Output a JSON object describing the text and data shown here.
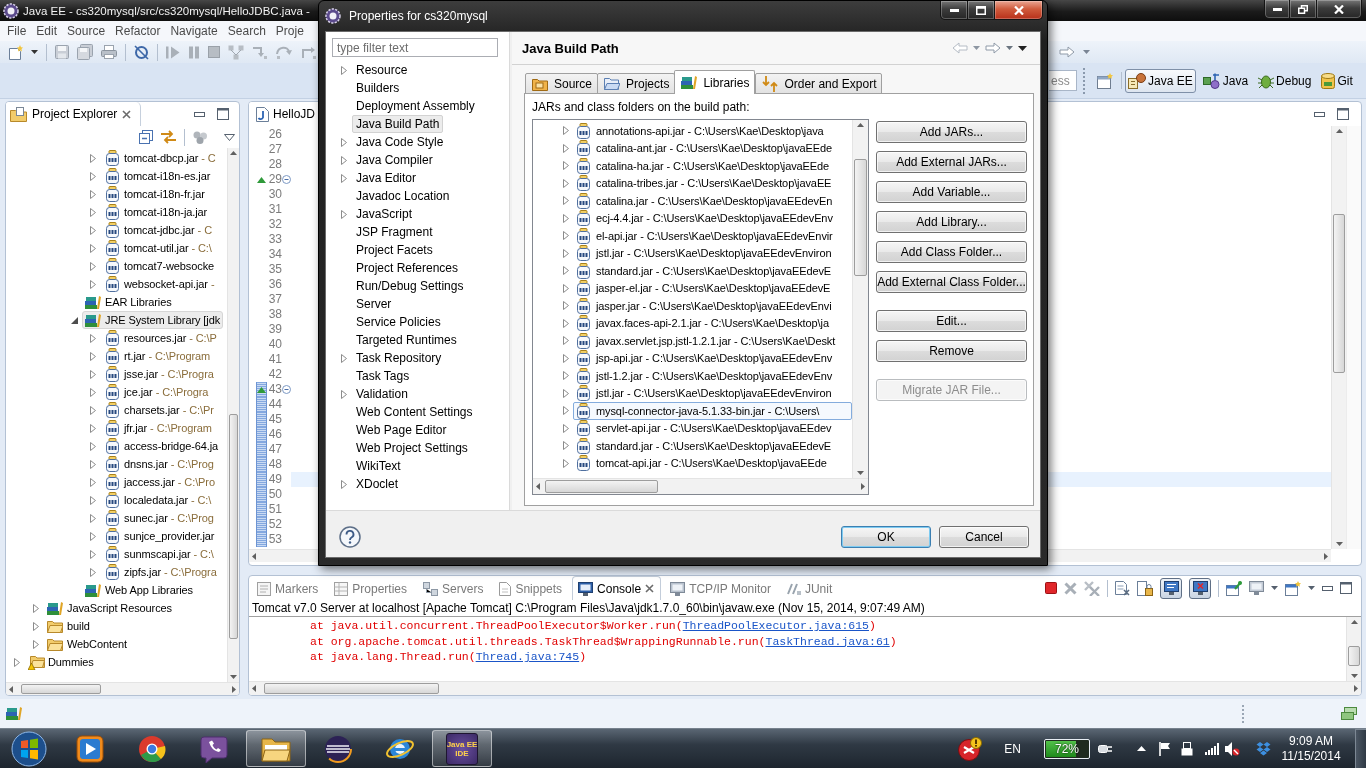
{
  "ide_window": {
    "title": "Java EE - cs320mysql/src/cs320mysql/HelloJDBC.java -",
    "menu": [
      "File",
      "Edit",
      "Source",
      "Refactor",
      "Navigate",
      "Search",
      "Proje"
    ],
    "quick_access": {
      "placeholder": "ess"
    },
    "perspectives": [
      {
        "label": "Java EE",
        "selected": true
      },
      {
        "label": "Java",
        "selected": false
      },
      {
        "label": "Debug",
        "selected": false
      },
      {
        "label": "Git",
        "selected": false
      }
    ],
    "project_explorer": {
      "title": "Project Explorer",
      "tree": [
        {
          "children": [
            {
              "children": [
                {
                  "children": [
                    {
                      "children": [
                        {
                          "kind": "jar",
                          "label": "tomcat-dbcp.jar",
                          "detail": "- C",
                          "expandable": true,
                          "expanded": false,
                          "selected": false
                        },
                        {
                          "kind": "jar",
                          "label": "tomcat-i18n-es.jar",
                          "expandable": true,
                          "expanded": false,
                          "selected": false
                        },
                        {
                          "kind": "jar",
                          "label": "tomcat-i18n-fr.jar",
                          "expandable": true,
                          "expanded": false,
                          "selected": false
                        },
                        {
                          "kind": "jar",
                          "label": "tomcat-i18n-ja.jar",
                          "expandable": true,
                          "expanded": false,
                          "selected": false
                        },
                        {
                          "kind": "jar",
                          "label": "tomcat-jdbc.jar",
                          "detail": "- C",
                          "expandable": true,
                          "expanded": false,
                          "selected": false
                        },
                        {
                          "kind": "jar",
                          "label": "tomcat-util.jar",
                          "detail": "- C:\\",
                          "expandable": true,
                          "expanded": false,
                          "selected": false
                        },
                        {
                          "kind": "jar",
                          "label": "tomcat7-websocke",
                          "expandable": true,
                          "expanded": false,
                          "selected": false
                        },
                        {
                          "kind": "jar",
                          "label": "websocket-api.jar",
                          "detail": "-",
                          "expandable": true,
                          "expanded": false,
                          "selected": false
                        }
                      ]
                    },
                    {
                      "kind": "library",
                      "label": "EAR Libraries",
                      "expandable": false,
                      "selected": false
                    },
                    {
                      "kind": "library",
                      "label": "JRE System Library [jdk",
                      "expandable": true,
                      "expanded": true,
                      "selected": true,
                      "children": [
                        {
                          "kind": "jar",
                          "label": "resources.jar",
                          "detail": "- C:\\P",
                          "expandable": true,
                          "expanded": false,
                          "selected": false
                        },
                        {
                          "kind": "jar",
                          "label": "rt.jar",
                          "detail": "- C:\\Program",
                          "expandable": true,
                          "expanded": false,
                          "selected": false
                        },
                        {
                          "kind": "jar",
                          "label": "jsse.jar",
                          "detail": "- C:\\Progra",
                          "expandable": true,
                          "expanded": false,
                          "selected": false
                        },
                        {
                          "kind": "jar",
                          "label": "jce.jar",
                          "detail": "- C:\\Progra",
                          "expandable": true,
                          "expanded": false,
                          "selected": false
                        },
                        {
                          "kind": "jar",
                          "label": "charsets.jar",
                          "detail": "- C:\\Pr",
                          "expandable": true,
                          "expanded": false,
                          "selected": false
                        },
                        {
                          "kind": "jar",
                          "label": "jfr.jar",
                          "detail": "- C:\\Program",
                          "expandable": true,
                          "expanded": false,
                          "selected": false
                        },
                        {
                          "kind": "jar",
                          "label": "access-bridge-64.ja",
                          "expandable": true,
                          "expanded": false,
                          "selected": false
                        },
                        {
                          "kind": "jar",
                          "label": "dnsns.jar",
                          "detail": "- C:\\Prog",
                          "expandable": true,
                          "expanded": false,
                          "selected": false
                        },
                        {
                          "kind": "jar",
                          "label": "jaccess.jar",
                          "detail": "- C:\\Pro",
                          "expandable": true,
                          "expanded": false,
                          "selected": false
                        },
                        {
                          "kind": "jar",
                          "label": "localedata.jar",
                          "detail": "- C:\\",
                          "expandable": true,
                          "expanded": false,
                          "selected": false
                        },
                        {
                          "kind": "jar",
                          "label": "sunec.jar",
                          "detail": "- C:\\Prog",
                          "expandable": true,
                          "expanded": false,
                          "selected": false
                        },
                        {
                          "kind": "jar",
                          "label": "sunjce_provider.jar",
                          "expandable": true,
                          "expanded": false,
                          "selected": false
                        },
                        {
                          "kind": "jar",
                          "label": "sunmscapi.jar",
                          "detail": "- C:\\",
                          "expandable": true,
                          "expanded": false,
                          "selected": false
                        },
                        {
                          "kind": "jar",
                          "label": "zipfs.jar",
                          "detail": "- C:\\Progra",
                          "expandable": true,
                          "expanded": false,
                          "selected": false
                        }
                      ]
                    },
                    {
                      "kind": "library",
                      "label": "Web App Libraries",
                      "expandable": false,
                      "selected": false
                    }
                  ]
                }
              ]
            },
            {
              "kind": "library",
              "label": "JavaScript Resources",
              "expandable": true,
              "expanded": false,
              "selected": false
            },
            {
              "kind": "folder",
              "label": "build",
              "expandable": true,
              "expanded": false,
              "selected": false
            },
            {
              "kind": "folder",
              "label": "WebContent",
              "expandable": true,
              "expanded": false,
              "selected": false
            }
          ]
        },
        {
          "kind": "project",
          "label": "Dummies",
          "expandable": true,
          "expanded": false,
          "selected": false
        }
      ]
    },
    "editor": {
      "tab": "HelloJD",
      "lines": [
        {
          "number": "26",
          "annotated": false,
          "in_range": false,
          "selected": false
        },
        {
          "number": "27",
          "annotated": false,
          "in_range": false,
          "selected": false
        },
        {
          "number": "28",
          "annotated": false,
          "in_range": false,
          "selected": false
        },
        {
          "number": "29",
          "annotated": true,
          "in_range": false,
          "selected": false
        },
        {
          "number": "30",
          "annotated": false,
          "in_range": false,
          "selected": false
        },
        {
          "number": "31",
          "annotated": false,
          "in_range": false,
          "selected": false
        },
        {
          "number": "32",
          "annotated": false,
          "in_range": false,
          "selected": false
        },
        {
          "number": "33",
          "annotated": false,
          "in_range": false,
          "selected": false
        },
        {
          "number": "34",
          "annotated": false,
          "in_range": false,
          "selected": false
        },
        {
          "number": "35",
          "annotated": false,
          "in_range": false,
          "selected": false
        },
        {
          "number": "36",
          "annotated": false,
          "in_range": false,
          "selected": false
        },
        {
          "number": "37",
          "annotated": false,
          "in_range": false,
          "selected": false
        },
        {
          "number": "38",
          "annotated": false,
          "in_range": false,
          "selected": false
        },
        {
          "number": "39",
          "annotated": false,
          "in_range": false,
          "selected": false
        },
        {
          "number": "40",
          "annotated": false,
          "in_range": false,
          "selected": false
        },
        {
          "number": "41",
          "annotated": false,
          "in_range": false,
          "selected": false
        },
        {
          "number": "42",
          "annotated": false,
          "in_range": false,
          "selected": false
        },
        {
          "number": "43",
          "annotated": true,
          "in_range": true,
          "selected": false
        },
        {
          "number": "44",
          "annotated": false,
          "in_range": true,
          "selected": false
        },
        {
          "number": "45",
          "annotated": false,
          "in_range": true,
          "selected": false
        },
        {
          "number": "46",
          "annotated": false,
          "in_range": true,
          "selected": false
        },
        {
          "number": "47",
          "annotated": false,
          "in_range": true,
          "selected": false
        },
        {
          "number": "48",
          "annotated": false,
          "in_range": true,
          "selected": false
        },
        {
          "number": "49",
          "annotated": false,
          "in_range": true,
          "selected": true
        },
        {
          "number": "50",
          "annotated": false,
          "in_range": true,
          "selected": false
        },
        {
          "number": "51",
          "annotated": false,
          "in_range": true,
          "selected": false
        },
        {
          "number": "52",
          "annotated": false,
          "in_range": true,
          "selected": false
        },
        {
          "number": "53",
          "annotated": false,
          "in_range": true,
          "selected": false
        }
      ]
    },
    "console": {
      "tabs": [
        {
          "label": "Markers",
          "selected": false
        },
        {
          "label": "Properties",
          "selected": false
        },
        {
          "label": "Servers",
          "selected": false
        },
        {
          "label": "Snippets",
          "selected": false
        },
        {
          "label": "Console",
          "selected": true
        },
        {
          "label": "TCP/IP Monitor",
          "selected": false
        },
        {
          "label": "JUnit",
          "selected": false
        }
      ],
      "stdout_toggle": {
        "pressed": true
      },
      "stderr_toggle": {
        "pressed": true
      },
      "header": "Tomcat v7.0 Server at localhost [Apache Tomcat] C:\\Program Files\\Java\\jdk1.7.0_60\\bin\\javaw.exe (Nov 15, 2014, 9:07:49 AM)",
      "lines": [
        {
          "text": "at java.util.concurrent.ThreadPoolExecutor$Worker.run(",
          "link": "ThreadPoolExecutor.java:615",
          "end": ")"
        },
        {
          "text": "at org.apache.tomcat.util.threads.TaskThread$WrappingRunnable.run(",
          "link": "TaskThread.java:61",
          "end": ")"
        },
        {
          "text": "at java.lang.Thread.run(",
          "link": "Thread.java:745",
          "end": ")"
        }
      ]
    }
  },
  "dialog": {
    "title": "Properties for cs320mysql",
    "filter": {
      "placeholder": "type filter text"
    },
    "categories": [
      {
        "label": "Resource",
        "expandable": true,
        "selected": false
      },
      {
        "label": "Builders",
        "expandable": false,
        "selected": false
      },
      {
        "label": "Deployment Assembly",
        "expandable": false,
        "selected": false
      },
      {
        "label": "Java Build Path",
        "expandable": false,
        "selected": true
      },
      {
        "label": "Java Code Style",
        "expandable": true,
        "selected": false
      },
      {
        "label": "Java Compiler",
        "expandable": true,
        "selected": false
      },
      {
        "label": "Java Editor",
        "expandable": true,
        "selected": false
      },
      {
        "label": "Javadoc Location",
        "expandable": false,
        "selected": false
      },
      {
        "label": "JavaScript",
        "expandable": true,
        "selected": false
      },
      {
        "label": "JSP Fragment",
        "expandable": false,
        "selected": false
      },
      {
        "label": "Project Facets",
        "expandable": false,
        "selected": false
      },
      {
        "label": "Project References",
        "expandable": false,
        "selected": false
      },
      {
        "label": "Run/Debug Settings",
        "expandable": false,
        "selected": false
      },
      {
        "label": "Server",
        "expandable": false,
        "selected": false
      },
      {
        "label": "Service Policies",
        "expandable": false,
        "selected": false
      },
      {
        "label": "Targeted Runtimes",
        "expandable": false,
        "selected": false
      },
      {
        "label": "Task Repository",
        "expandable": true,
        "selected": false
      },
      {
        "label": "Task Tags",
        "expandable": false,
        "selected": false
      },
      {
        "label": "Validation",
        "expandable": true,
        "selected": false
      },
      {
        "label": "Web Content Settings",
        "expandable": false,
        "selected": false
      },
      {
        "label": "Web Page Editor",
        "expandable": false,
        "selected": false
      },
      {
        "label": "Web Project Settings",
        "expandable": false,
        "selected": false
      },
      {
        "label": "WikiText",
        "expandable": false,
        "selected": false
      },
      {
        "label": "XDoclet",
        "expandable": true,
        "selected": false
      }
    ],
    "page_title": "Java Build Path",
    "tabs": [
      {
        "label": "Source",
        "selected": false
      },
      {
        "label": "Projects",
        "selected": false
      },
      {
        "label": "Libraries",
        "selected": true
      },
      {
        "label": "Order and Export",
        "selected": false
      }
    ],
    "list_label": "JARs and class folders on the build path:",
    "libraries": [
      {
        "label": "annotations-api.jar - C:\\Users\\Kae\\Desktop\\java",
        "selected": false
      },
      {
        "label": "catalina-ant.jar - C:\\Users\\Kae\\Desktop\\javaEEde",
        "selected": false
      },
      {
        "label": "catalina-ha.jar - C:\\Users\\Kae\\Desktop\\javaEEde",
        "selected": false
      },
      {
        "label": "catalina-tribes.jar - C:\\Users\\Kae\\Desktop\\javaEE",
        "selected": false
      },
      {
        "label": "catalina.jar - C:\\Users\\Kae\\Desktop\\javaEEdevEn",
        "selected": false
      },
      {
        "label": "ecj-4.4.jar - C:\\Users\\Kae\\Desktop\\javaEEdevEnv",
        "selected": false
      },
      {
        "label": "el-api.jar - C:\\Users\\Kae\\Desktop\\javaEEdevEnvir",
        "selected": false
      },
      {
        "label": "jstl.jar - C:\\Users\\Kae\\Desktop\\javaEEdevEnviron",
        "selected": false
      },
      {
        "label": "standard.jar - C:\\Users\\Kae\\Desktop\\javaEEdevE",
        "selected": false
      },
      {
        "label": "jasper-el.jar - C:\\Users\\Kae\\Desktop\\javaEEdevE",
        "selected": false
      },
      {
        "label": "jasper.jar - C:\\Users\\Kae\\Desktop\\javaEEdevEnvi",
        "selected": false
      },
      {
        "label": "javax.faces-api-2.1.jar - C:\\Users\\Kae\\Desktop\\ja",
        "selected": false
      },
      {
        "label": "javax.servlet.jsp.jstl-1.2.1.jar - C:\\Users\\Kae\\Deskt",
        "selected": false
      },
      {
        "label": "jsp-api.jar - C:\\Users\\Kae\\Desktop\\javaEEdevEnv",
        "selected": false
      },
      {
        "label": "jstl-1.2.jar - C:\\Users\\Kae\\Desktop\\javaEEdevEnv",
        "selected": false
      },
      {
        "label": "jstl.jar - C:\\Users\\Kae\\Desktop\\javaEEdevEnviron",
        "selected": false
      },
      {
        "label": "mysql-connector-java-5.1.33-bin.jar - C:\\Users\\",
        "selected": true
      },
      {
        "label": "servlet-api.jar - C:\\Users\\Kae\\Desktop\\javaEEdev",
        "selected": false
      },
      {
        "label": "standard.jar - C:\\Users\\Kae\\Desktop\\javaEEdevE",
        "selected": false
      },
      {
        "label": "tomcat-api.jar - C:\\Users\\Kae\\Desktop\\javaEEde",
        "selected": false
      }
    ],
    "button_groups": [
      [
        {
          "label": "Add JARs...",
          "disabled": false
        },
        {
          "label": "Add External JARs...",
          "disabled": false
        },
        {
          "label": "Add Variable...",
          "disabled": false
        },
        {
          "label": "Add Library...",
          "disabled": false
        },
        {
          "label": "Add Class Folder...",
          "disabled": false
        },
        {
          "label": "Add External Class Folder...",
          "disabled": false
        }
      ],
      [
        {
          "label": "Edit...",
          "disabled": false
        },
        {
          "label": "Remove",
          "disabled": false
        }
      ],
      [
        {
          "label": "Migrate JAR File...",
          "disabled": true
        }
      ]
    ],
    "footer_buttons": [
      {
        "label": "OK",
        "default": true
      },
      {
        "label": "Cancel",
        "default": false
      }
    ]
  },
  "taskbar": {
    "apps": [
      {
        "running": false
      },
      {
        "running": false
      },
      {
        "running": false
      },
      {
        "running": true
      },
      {
        "running": false
      },
      {
        "running": false
      },
      {
        "running": true,
        "icon_text": [
          "Java EE",
          "IDE"
        ]
      }
    ],
    "tray": {
      "language": "EN",
      "battery": {
        "label": "72%",
        "level": 0.72
      },
      "time": "9:09 AM",
      "date": "11/15/2014"
    }
  }
}
